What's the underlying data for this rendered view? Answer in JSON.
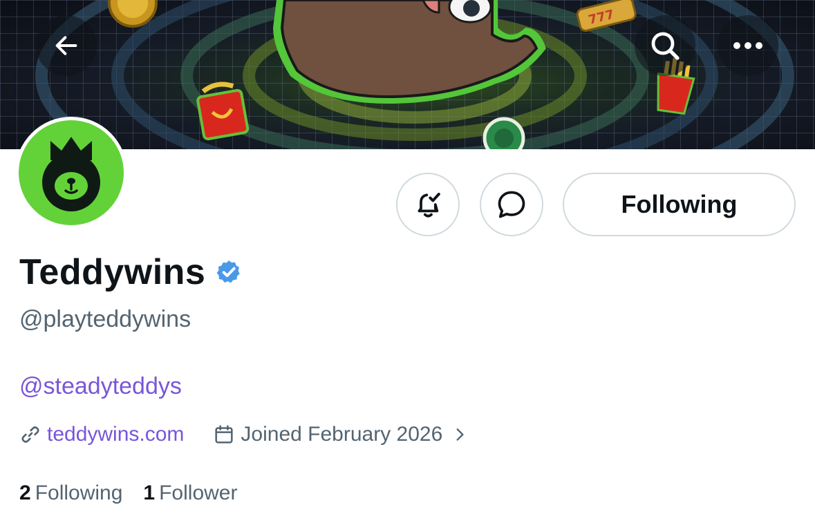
{
  "header": {
    "back_icon": "arrow-left-icon",
    "search_icon": "search-icon",
    "more_icon": "more-horizontal-icon"
  },
  "profile": {
    "display_name": "Teddywins",
    "verified": true,
    "verified_color": "#4a99e9",
    "handle": "@playteddywins",
    "bio_mention": "@steadyteddys",
    "website": "teddywins.com",
    "joined": "Joined February 2026",
    "avatar_bg": "#63d239"
  },
  "actions": {
    "notifications_icon": "bell-check-icon",
    "message_icon": "message-bubble-icon",
    "follow_label": "Following"
  },
  "stats": {
    "following_count": "2",
    "following_label": "Following",
    "followers_count": "1",
    "followers_label": "Follower"
  },
  "colors": {
    "link": "#7856d9",
    "secondary_text": "#536471",
    "border": "#cfd9de"
  }
}
